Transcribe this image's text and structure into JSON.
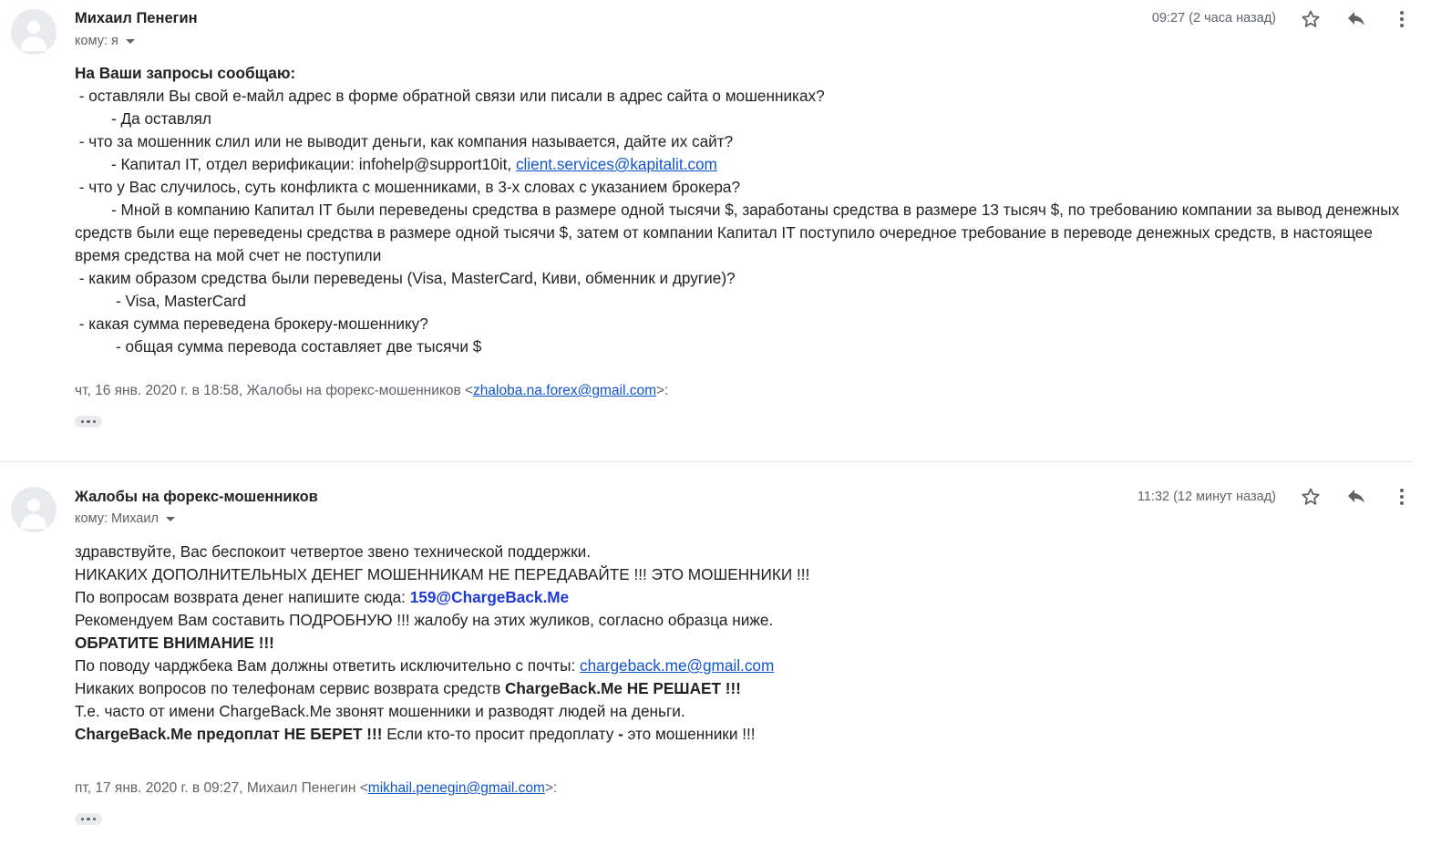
{
  "message1": {
    "sender": "Михаил Пенегин",
    "to_label": "кому: я",
    "time": "09:27 (2 часа назад)",
    "lines": {
      "l1": "На Ваши запросы сообщаю:",
      "l2": " - оставляли Вы свой е-майл адрес в форме обратной связи или писали в адрес сайта о мошенниках?",
      "l3": "- Да  оставлял",
      "l4": " - что за мошенник слил или не выводит деньги, как компания называется, дайте их сайт?",
      "l5a": "- Капитал IT, отдел верификации: infohelp@support10it, ",
      "l5b": "client.services@kapitalit.com",
      "l6": " - что у Вас случилось, суть конфликта с мошенниками, в 3-х словах с указанием брокера?",
      "l7": "- Мной в компанию Капитал IT были переведены средства в размере одной тысячи $, заработаны средства в размере 13 тысяч $, по требованию компании за вывод денежных средств были еще переведены средства в размере одной тысячи $, затем от компании Капитал IT поступило очередное требование в переводе денежных средств, в настоящее время средства на мой счет не поступили",
      "l8": " - каким образом средства были переведены (Visa, MasterCard, Киви, обменник и другие)?",
      "l9": "- Visa, MasterCard",
      "l10": " - какая сумма переведена брокеру-мошеннику?",
      "l11": "- общая сумма перевода составляет две тысячи $"
    },
    "quote_prefix": "чт, 16 янв. 2020 г. в 18:58, Жалобы на форекс-мошенников <",
    "quote_email": "zhaloba.na.forex@gmail.com",
    "quote_suffix": ">:"
  },
  "message2": {
    "sender": "Жалобы на форекс-мошенников",
    "to_label": "кому: Михаил",
    "time": "11:32 (12 минут назад)",
    "lines": {
      "l1": "здравствуйте, Вас беспокоит четвертое звено технической поддержки.",
      "l2": "НИКАКИХ ДОПОЛНИТЕЛЬНЫХ ДЕНЕГ МОШЕННИКАМ НЕ ПЕРЕДАВАЙТЕ !!! ЭТО МОШЕННИКИ !!!",
      "l3a": "По вопросам возврата денег напишите сюда: ",
      "l3b": "159@ChargeBack.Me",
      "l4": "Рекомендуем Вам составить ПОДРОБНУЮ !!! жалобу на этих жуликов, согласно образца ниже.",
      "l5": "ОБРАТИТЕ ВНИМАНИЕ !!!",
      "l6a": "По поводу чарджбека Вам должны ответить исключительно с почты: ",
      "l6b": "chargeback.me@gmail.com",
      "l7a": "Никаких вопросов по телефонам сервис возврата средств ",
      "l7b": "ChargeBack.Me НЕ РЕШАЕТ !!!",
      "l8": "Т.е. часто от имени ChargeBack.Me звонят мошенники и разводят людей на деньги.",
      "l9a": "ChargeBack.Me предоплат НЕ БЕРЕТ !!!",
      "l9b": " Если кто-то просит предоплату ",
      "l9c": "-",
      "l9d": " это мошенники !!!"
    },
    "quote_prefix": "пт, 17 янв. 2020 г. в 09:27, Михаил Пенегин <",
    "quote_email": "mikhail.penegin@gmail.com",
    "quote_suffix": ">:"
  },
  "icons": {
    "star": "star-icon",
    "reply": "reply-icon",
    "more": "more-vert-icon",
    "avatar": "default-avatar-icon",
    "expand": "show-trimmed-content-icon"
  },
  "colors": {
    "link": "#1155cc",
    "meta": "#5f6368",
    "text": "#222222"
  }
}
